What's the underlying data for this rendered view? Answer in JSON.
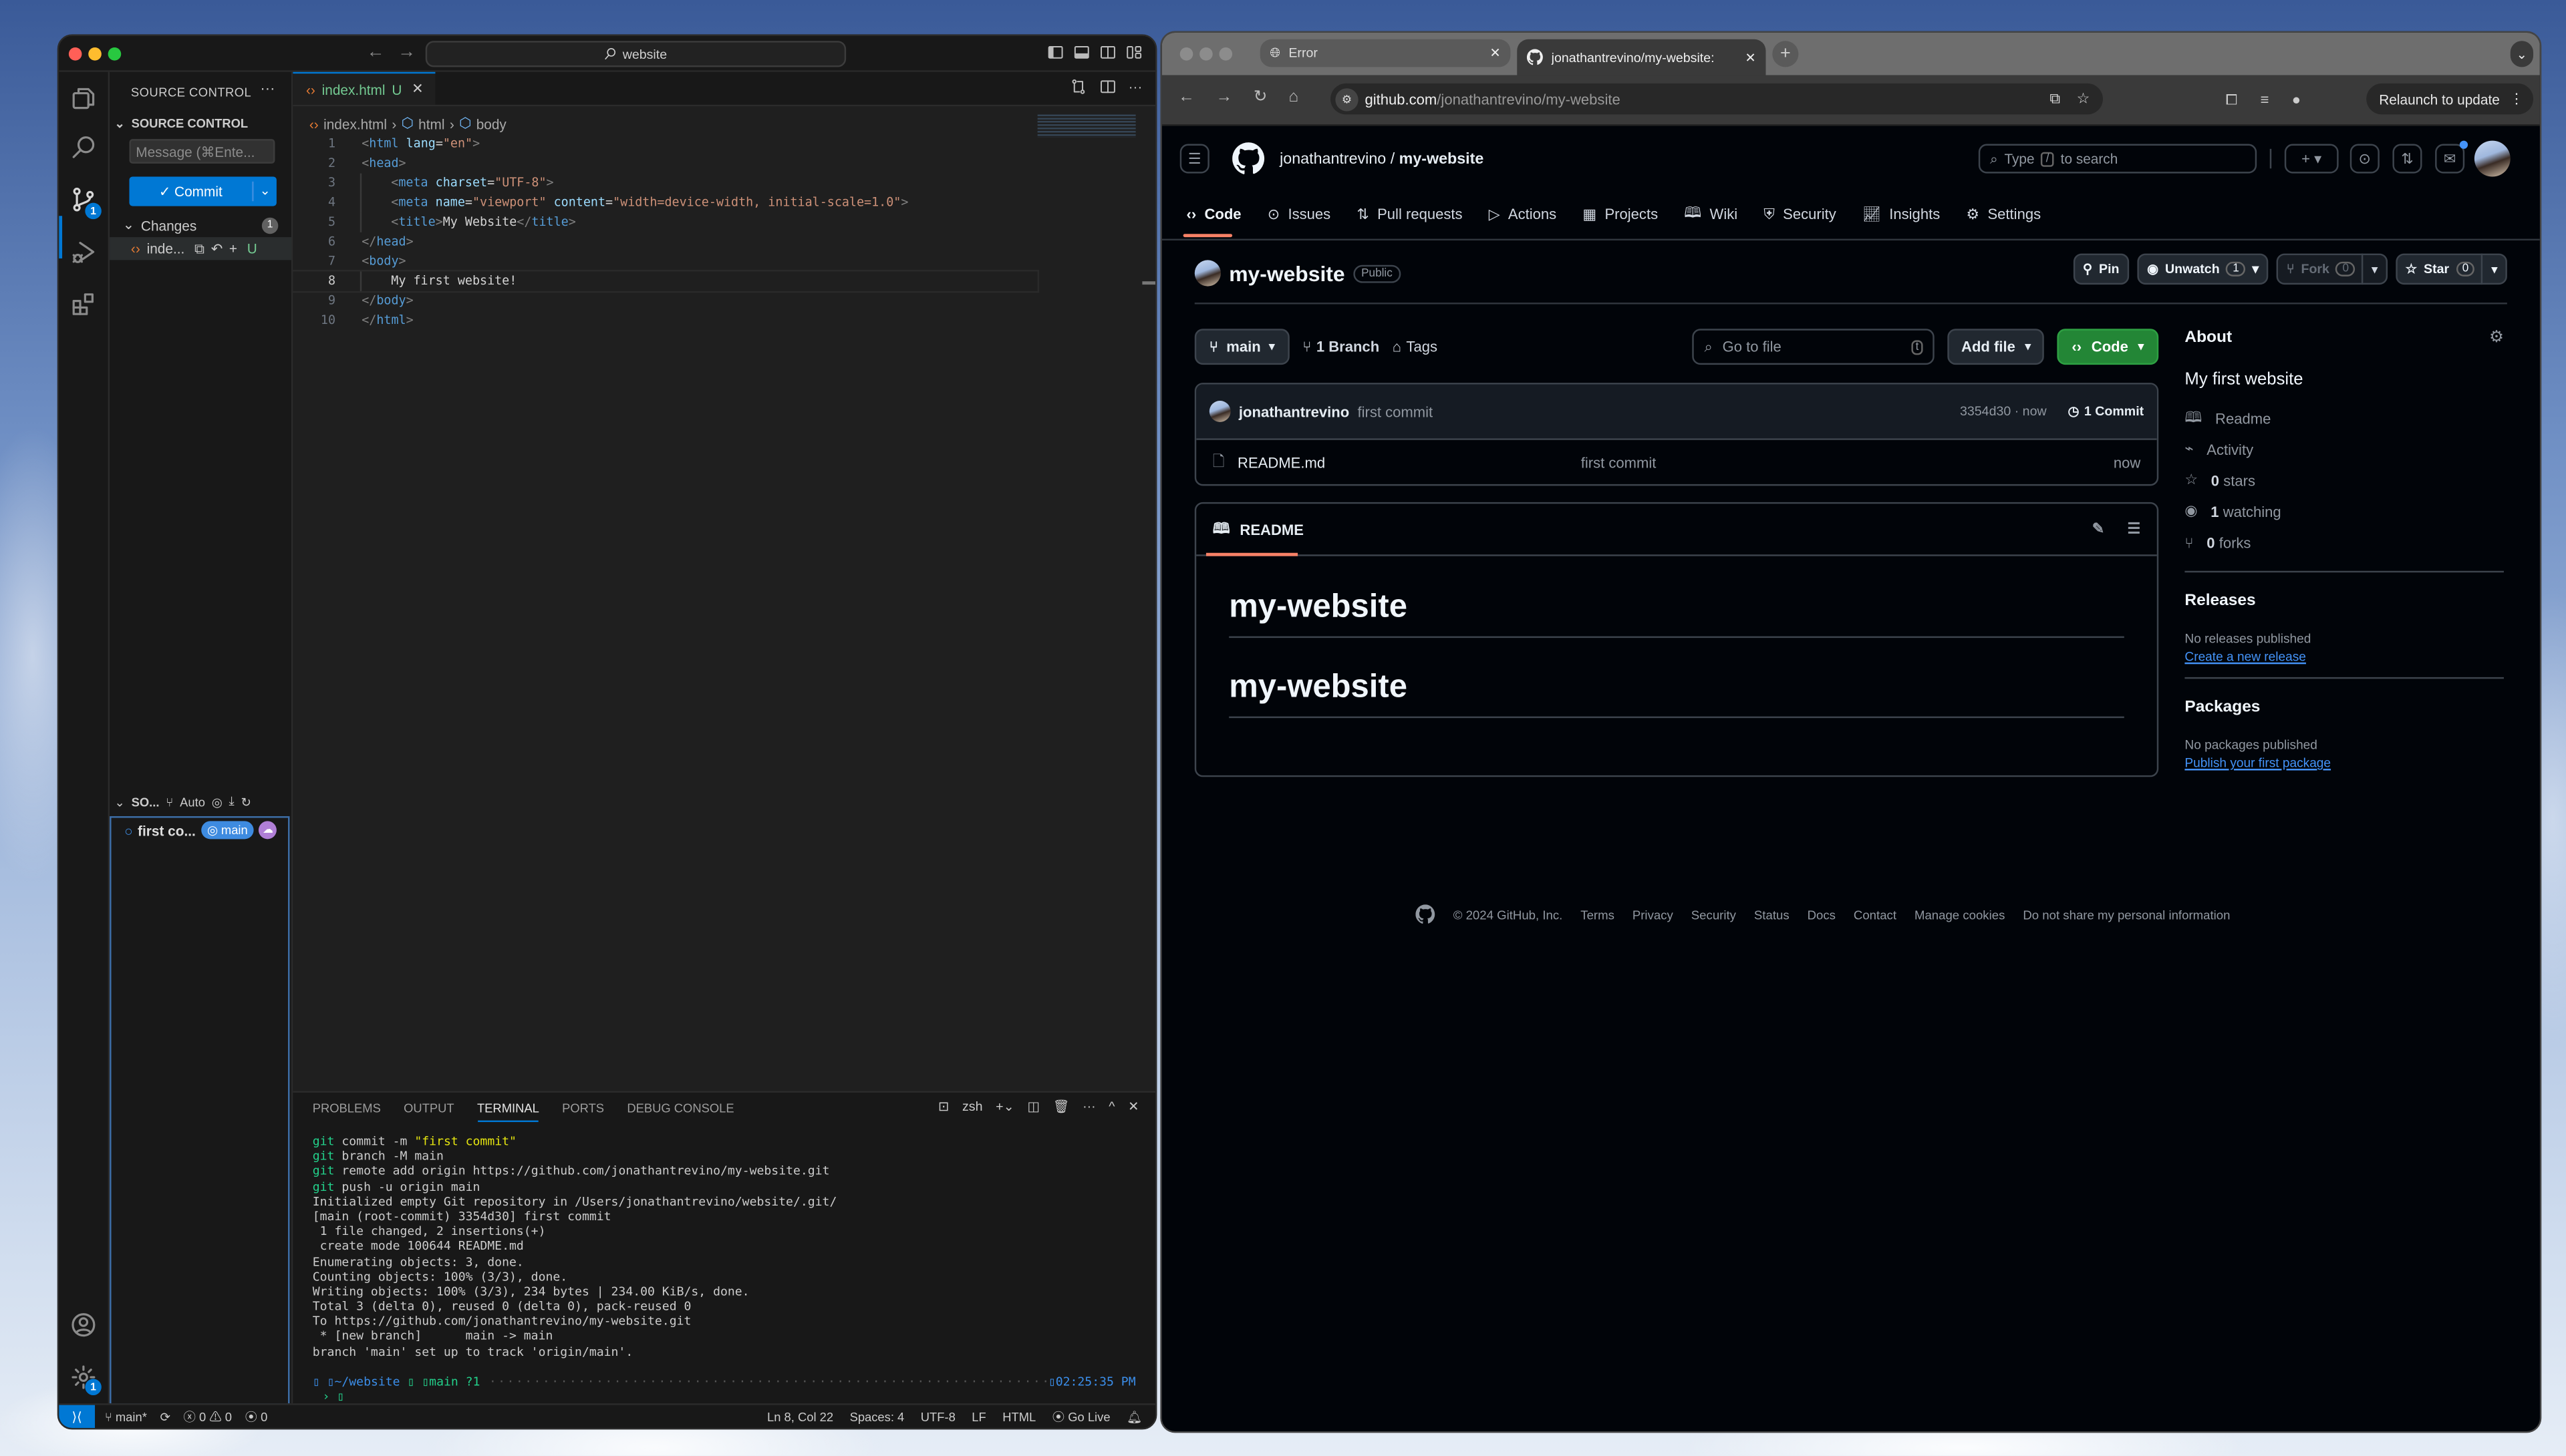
{
  "vscode": {
    "search_label": "website",
    "activity_badges": {
      "source_control": "1",
      "settings": "1"
    },
    "sidebar": {
      "header": "SOURCE CONTROL",
      "section": "SOURCE CONTROL",
      "message_placeholder": "Message (⌘Ente...",
      "commit_label": "Commit",
      "changes_label": "Changes",
      "changes_count": "1",
      "changed_file": "inde...",
      "changed_file_status": "U",
      "graph_header": "SO...",
      "graph_mode": "Auto",
      "graph_commit": "first co...",
      "graph_branch": "main"
    },
    "editor": {
      "tab_name": "index.html",
      "tab_status": "U",
      "breadcrumb": [
        "index.html",
        "html",
        "body"
      ],
      "lines": [
        {
          "n": "1",
          "indent": 0,
          "parts": [
            [
              "br",
              "<"
            ],
            [
              "tg",
              "html"
            ],
            [
              "at",
              " lang"
            ],
            [
              "tx",
              "="
            ],
            [
              "st",
              "\"en\""
            ],
            [
              "br",
              ">"
            ]
          ]
        },
        {
          "n": "2",
          "indent": 0,
          "parts": [
            [
              "br",
              "<"
            ],
            [
              "tg",
              "head"
            ],
            [
              "br",
              ">"
            ]
          ]
        },
        {
          "n": "3",
          "indent": 1,
          "parts": [
            [
              "br",
              "<"
            ],
            [
              "tg",
              "meta"
            ],
            [
              "at",
              " charset"
            ],
            [
              "tx",
              "="
            ],
            [
              "st",
              "\"UTF-8\""
            ],
            [
              "br",
              ">"
            ]
          ]
        },
        {
          "n": "4",
          "indent": 1,
          "parts": [
            [
              "br",
              "<"
            ],
            [
              "tg",
              "meta"
            ],
            [
              "at",
              " name"
            ],
            [
              "tx",
              "="
            ],
            [
              "st",
              "\"viewport\""
            ],
            [
              "at",
              " content"
            ],
            [
              "tx",
              "="
            ],
            [
              "st",
              "\"width=device-width, initial-scale=1.0\""
            ],
            [
              "br",
              ">"
            ]
          ]
        },
        {
          "n": "5",
          "indent": 1,
          "parts": [
            [
              "br",
              "<"
            ],
            [
              "tg",
              "title"
            ],
            [
              "br",
              ">"
            ],
            [
              "tx",
              "My Website"
            ],
            [
              "br",
              "</"
            ],
            [
              "tg",
              "title"
            ],
            [
              "br",
              ">"
            ]
          ]
        },
        {
          "n": "6",
          "indent": 0,
          "parts": [
            [
              "br",
              "</"
            ],
            [
              "tg",
              "head"
            ],
            [
              "br",
              ">"
            ]
          ]
        },
        {
          "n": "7",
          "indent": 0,
          "parts": [
            [
              "br",
              "<"
            ],
            [
              "tg",
              "body"
            ],
            [
              "br",
              ">"
            ]
          ]
        },
        {
          "n": "8",
          "indent": 1,
          "parts": [
            [
              "tx",
              "My first website!"
            ]
          ],
          "current": true
        },
        {
          "n": "9",
          "indent": 0,
          "parts": [
            [
              "br",
              "</"
            ],
            [
              "tg",
              "body"
            ],
            [
              "br",
              ">"
            ]
          ]
        },
        {
          "n": "10",
          "indent": 0,
          "parts": [
            [
              "br",
              "</"
            ],
            [
              "tg",
              "html"
            ],
            [
              "br",
              ">"
            ]
          ]
        }
      ]
    },
    "panel": {
      "tabs": [
        "PROBLEMS",
        "OUTPUT",
        "TERMINAL",
        "PORTS",
        "DEBUG CONSOLE"
      ],
      "active_tab": "TERMINAL",
      "shell": "zsh",
      "terminal_lines": [
        {
          "cmd": "git",
          "rest": " commit -m ",
          "str": "\"first commit\""
        },
        {
          "cmd": "git",
          "rest": " branch -M main"
        },
        {
          "cmd": "git",
          "rest": " remote add origin https://github.com/jonathantrevino/my-website.git"
        },
        {
          "cmd": "git",
          "rest": " push -u origin main"
        },
        {
          "rest": "Initialized empty Git repository in /Users/jonathantrevino/website/.git/"
        },
        {
          "rest": "[main (root-commit) 3354d30] first commit"
        },
        {
          "rest": " 1 file changed, 2 insertions(+)"
        },
        {
          "rest": " create mode 100644 README.md"
        },
        {
          "rest": "Enumerating objects: 3, done."
        },
        {
          "rest": "Counting objects: 100% (3/3), done."
        },
        {
          "rest": "Writing objects: 100% (3/3), 234 bytes | 234.00 KiB/s, done."
        },
        {
          "rest": "Total 3 (delta 0), reused 0 (delta 0), pack-reused 0"
        },
        {
          "rest": "To https://github.com/jonathantrevino/my-website.git"
        },
        {
          "rest": " * [new branch]      main -> main"
        },
        {
          "rest": "branch 'main' set up to track 'origin/main'."
        }
      ],
      "prompt_path": "~/website",
      "prompt_branch": "main ?1",
      "prompt_time": "02:25:35 PM"
    },
    "status": {
      "branch": "main*",
      "errors": "0",
      "warnings": "0",
      "ports": "0",
      "position": "Ln 8, Col 22",
      "spaces": "Spaces: 4",
      "encoding": "UTF-8",
      "eol": "LF",
      "language": "HTML",
      "golive": "Go Live"
    }
  },
  "browser": {
    "tabs": [
      {
        "title": "Error",
        "active": false
      },
      {
        "title": "jonathantrevino/my-website:",
        "active": true
      }
    ],
    "url_host": "github.com",
    "url_path": "/jonathantrevino/my-website",
    "relaunch_label": "Relaunch to update"
  },
  "github": {
    "owner": "jonathantrevino",
    "repo": "my-website",
    "search_placeholder_pre": "Type",
    "search_key": "/",
    "search_placeholder_post": "to search",
    "nav": [
      "Code",
      "Issues",
      "Pull requests",
      "Actions",
      "Projects",
      "Wiki",
      "Security",
      "Insights",
      "Settings"
    ],
    "visibility": "Public",
    "pin": "Pin",
    "unwatch": "Unwatch",
    "watch_count": "1",
    "fork": "Fork",
    "fork_count": "0",
    "star": "Star",
    "star_count": "0",
    "branch": "main",
    "branches": "1 Branch",
    "tags": "Tags",
    "goto_placeholder": "Go to file",
    "goto_key": "t",
    "add_file": "Add file",
    "code_btn": "Code",
    "commit": {
      "user": "jonathantrevino",
      "message": "first commit",
      "hash_time": "3354d30 · now",
      "count": "1 Commit"
    },
    "files": [
      {
        "name": "README.md",
        "message": "first commit",
        "time": "now"
      }
    ],
    "readme_title": "README",
    "readme_headings": [
      "my-website",
      "my-website"
    ],
    "about": {
      "title": "About",
      "description": "My first website",
      "items": [
        {
          "icon": "book-icon",
          "label": "Readme"
        },
        {
          "icon": "pulse-icon",
          "label": "Activity"
        },
        {
          "icon": "star-icon",
          "count": "0",
          "label": "stars"
        },
        {
          "icon": "eye-icon",
          "count": "1",
          "label": "watching"
        },
        {
          "icon": "fork-icon",
          "count": "0",
          "label": "forks"
        }
      ],
      "releases_title": "Releases",
      "releases_text": "No releases published",
      "releases_link": "Create a new release",
      "packages_title": "Packages",
      "packages_text": "No packages published",
      "packages_link": "Publish your first package"
    },
    "footer": [
      "© 2024 GitHub, Inc.",
      "Terms",
      "Privacy",
      "Security",
      "Status",
      "Docs",
      "Contact",
      "Manage cookies",
      "Do not share my personal information"
    ]
  }
}
